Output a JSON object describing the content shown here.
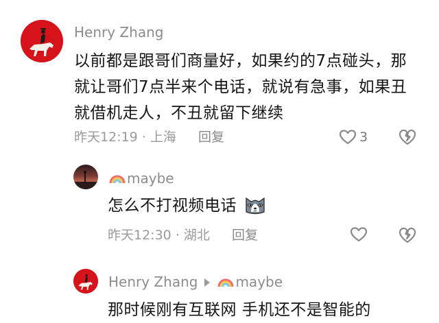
{
  "comments": [
    {
      "username": "Henry Zhang",
      "text": "以前都是跟哥们商量好，如果约的7点碰头，那就让哥们7点半来个电话，就说有急事，如果丑就借机走人，不丑就留下继续",
      "time": "昨天12:19",
      "location": "上海",
      "reply_label": "回复",
      "like_count": "3"
    }
  ],
  "replies": [
    {
      "username": "maybe",
      "text": "怎么不打视频电话",
      "time": "昨天12:30",
      "location": "湖北",
      "reply_label": "回复"
    },
    {
      "username": "Henry Zhang",
      "reply_to": "maybe",
      "text": "那时候刚有互联网 手机还不是智能的"
    }
  ],
  "colors": {
    "avatar_red": "#d6121b",
    "meta_gray": "#9a9a9a"
  }
}
